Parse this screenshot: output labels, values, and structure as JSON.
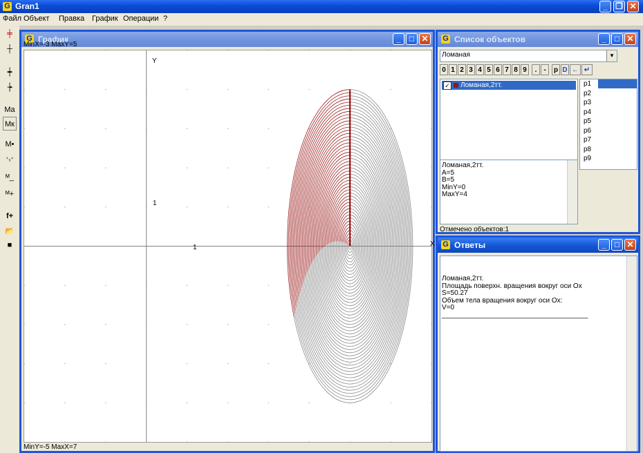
{
  "app": {
    "title": "Gran1"
  },
  "menu": [
    "Файл",
    "Объект",
    "Правка",
    "График",
    "Операции",
    "?"
  ],
  "graph_window": {
    "title": "График",
    "top_label": "MinX=-3  MaxY=5",
    "bottom_label": "MinY=-5  MaxX=7",
    "axis_y": "Y",
    "axis_x": "X",
    "tick_x": "1",
    "tick_y": "1",
    "chart_data": {
      "type": "line",
      "xlim": [
        -3,
        7
      ],
      "ylim": [
        -5,
        5
      ],
      "series": [
        {
          "x": [
            5,
            5
          ],
          "y": [
            0,
            4
          ]
        }
      ],
      "colors": {
        "front": "#9b1c1c",
        "back": "#888888",
        "axis": "#808080"
      }
    }
  },
  "objects_window": {
    "title": "Список объектов",
    "dropdown_value": "Ломаная",
    "buttons": [
      "0",
      "1",
      "2",
      "3",
      "4",
      "5",
      "6",
      "7",
      "8",
      "9",
      ".",
      "-",
      "p",
      "D",
      "←",
      "↵"
    ],
    "tree_item": "Ломаная,2тт.",
    "params": [
      "p1",
      "p2",
      "p3",
      "p4",
      "p5",
      "p6",
      "p7",
      "p8",
      "p9"
    ],
    "info": [
      "Ломаная,2тт.",
      "A=5",
      "B=5",
      "MinY=0",
      "MaxY=4"
    ],
    "status": "Отмечено объектов:1"
  },
  "answers_window": {
    "title": "Ответы",
    "lines": [
      "Ломаная,2тт.",
      "Площадь поверхн. вращения вокруг оси Ox",
      "S=50.27",
      "Объем тела вращения вокруг оси Ox:",
      "V=0"
    ],
    "divider": "______________________________________"
  }
}
